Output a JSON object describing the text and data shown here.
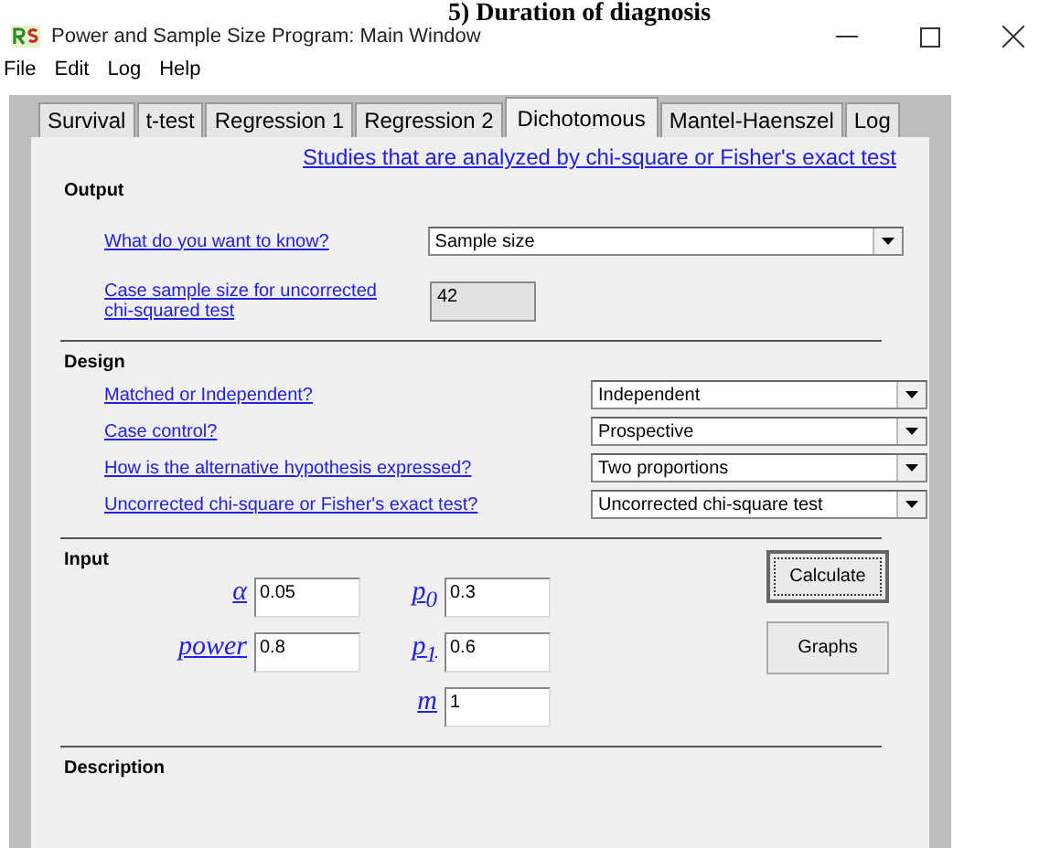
{
  "doc_heading": "5) Duration of diagnosis",
  "window": {
    "title": "Power and Sample Size Program:  Main Window"
  },
  "menu": [
    "File",
    "Edit",
    "Log",
    "Help"
  ],
  "tabs": [
    {
      "label": "Survival",
      "selected": false
    },
    {
      "label": "t-test",
      "selected": false
    },
    {
      "label": "Regression 1",
      "selected": false
    },
    {
      "label": "Regression 2",
      "selected": false
    },
    {
      "label": "Dichotomous",
      "selected": true
    },
    {
      "label": "Mantel-Haenszel",
      "selected": false
    },
    {
      "label": "Log",
      "selected": false
    }
  ],
  "link": "Studies that are analyzed by chi-square or Fisher's exact test",
  "output": {
    "title": "Output",
    "question": {
      "label": "What do you want to know?",
      "value": "Sample size"
    },
    "result": {
      "label": "Case sample size for uncorrected chi-squared test",
      "value": "42"
    }
  },
  "design": {
    "title": "Design",
    "rows": [
      {
        "label": "Matched or Independent?",
        "value": "Independent"
      },
      {
        "label": "Case control?",
        "value": "Prospective"
      },
      {
        "label": "How is the alternative hypothesis expressed?",
        "value": "Two proportions"
      },
      {
        "label": "Uncorrected chi-square or Fisher's exact test?",
        "value": "Uncorrected chi-square test"
      }
    ]
  },
  "input": {
    "title": "Input",
    "column_1": [
      {
        "label": "α",
        "value": "0.05"
      },
      {
        "label": "power",
        "value": "0.8"
      }
    ],
    "column_2": [
      {
        "label": "p$_{0}$",
        "value": "0.3"
      },
      {
        "label": "p$_{1}$",
        "value": "0.6"
      },
      {
        "label": "m",
        "value": "1"
      }
    ],
    "buttons": [
      {
        "label": "Calculate",
        "default": true
      },
      {
        "label": "Graphs",
        "default": false
      }
    ]
  },
  "description": {
    "title": "Description"
  }
}
